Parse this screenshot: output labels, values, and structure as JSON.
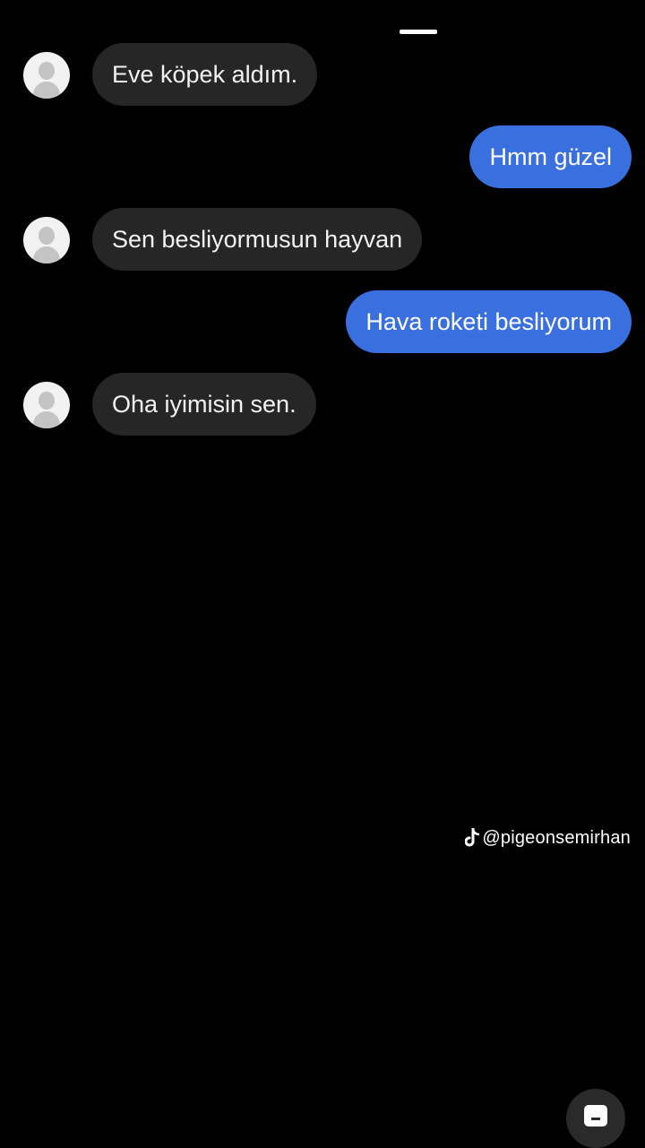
{
  "conversation": {
    "messages": [
      {
        "sender": "other",
        "text": "Eve köpek aldım."
      },
      {
        "sender": "me",
        "text": "Hmm güzel"
      },
      {
        "sender": "other",
        "text": "Sen besliyormusun hayvan"
      },
      {
        "sender": "me",
        "text": "Hava roketi besliyorum"
      },
      {
        "sender": "other",
        "text": "Oha iyimisin sen."
      }
    ]
  },
  "watermark": {
    "handle": "@pigeonsemirhan",
    "icon": "tiktok-icon"
  },
  "colors": {
    "background": "#000000",
    "incoming_bubble": "#262626",
    "outgoing_bubble": "#3a6fe0",
    "text": "#ffffff"
  }
}
